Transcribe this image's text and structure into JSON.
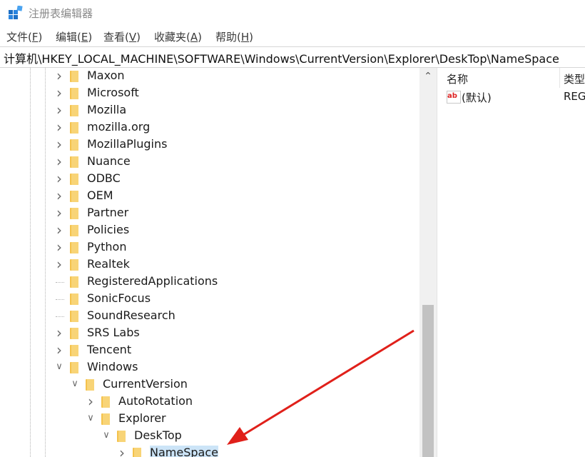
{
  "window": {
    "title": "注册表编辑器"
  },
  "menu": [
    {
      "label": "文件(",
      "accel": "F",
      "close": ")"
    },
    {
      "label": "编辑(",
      "accel": "E",
      "close": ")"
    },
    {
      "label": "查看(",
      "accel": "V",
      "close": ")"
    },
    {
      "label": "收藏夹(",
      "accel": "A",
      "close": ")"
    },
    {
      "label": "帮助(",
      "accel": "H",
      "close": ")"
    }
  ],
  "address": "计算机\\HKEY_LOCAL_MACHINE\\SOFTWARE\\Windows\\CurrentVersion\\Explorer\\DeskTop\\NameSpace",
  "tree": [
    {
      "label": "Maxon",
      "expander": "collapsed"
    },
    {
      "label": "Microsoft",
      "expander": "collapsed"
    },
    {
      "label": "Mozilla",
      "expander": "collapsed"
    },
    {
      "label": "mozilla.org",
      "expander": "collapsed"
    },
    {
      "label": "MozillaPlugins",
      "expander": "collapsed"
    },
    {
      "label": "Nuance",
      "expander": "collapsed"
    },
    {
      "label": "ODBC",
      "expander": "collapsed"
    },
    {
      "label": "OEM",
      "expander": "collapsed"
    },
    {
      "label": "Partner",
      "expander": "collapsed"
    },
    {
      "label": "Policies",
      "expander": "collapsed"
    },
    {
      "label": "Python",
      "expander": "collapsed"
    },
    {
      "label": "Realtek",
      "expander": "collapsed"
    },
    {
      "label": "RegisteredApplications",
      "expander": "none"
    },
    {
      "label": "SonicFocus",
      "expander": "none"
    },
    {
      "label": "SoundResearch",
      "expander": "none"
    },
    {
      "label": "SRS Labs",
      "expander": "collapsed"
    },
    {
      "label": "Tencent",
      "expander": "collapsed"
    },
    {
      "label": "Windows",
      "expander": "expanded"
    },
    {
      "label": "CurrentVersion",
      "expander": "expanded"
    },
    {
      "label": "AutoRotation",
      "expander": "collapsed"
    },
    {
      "label": "Explorer",
      "expander": "expanded"
    },
    {
      "label": "DeskTop",
      "expander": "expanded"
    },
    {
      "label": "NameSpace",
      "expander": "collapsed",
      "selected": true
    }
  ],
  "values_pane": {
    "headers": {
      "name": "名称",
      "type": "类型"
    },
    "rows": [
      {
        "name": "(默认)",
        "type": "REG"
      }
    ]
  },
  "colors": {
    "folder": "#f4c24c",
    "selection": "#cce4f7",
    "arrow": "#e0201a"
  }
}
